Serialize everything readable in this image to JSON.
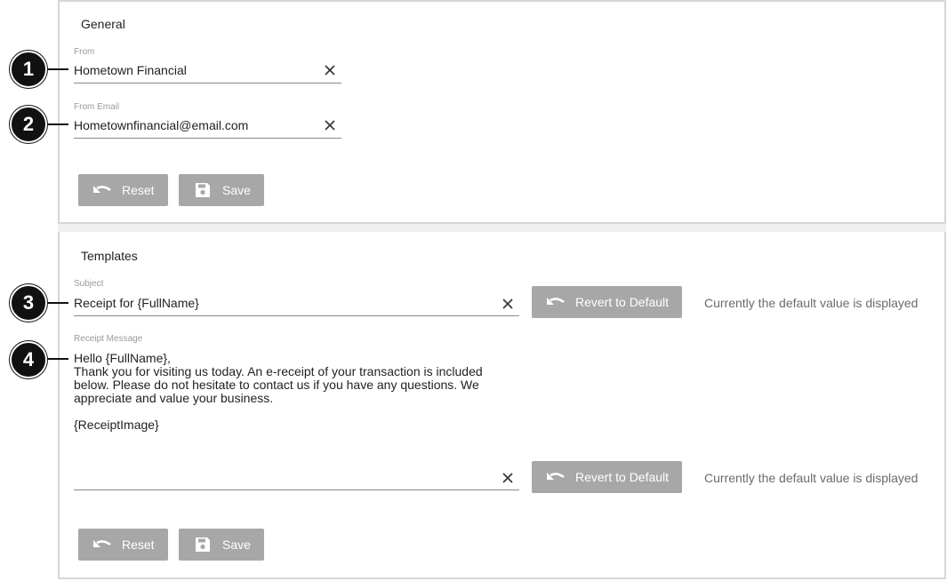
{
  "general": {
    "title": "General",
    "from": {
      "label": "From",
      "value": "Hometown Financial"
    },
    "from_email": {
      "label": "From Email",
      "value": "Hometownfinancial@email.com"
    },
    "reset_label": "Reset",
    "save_label": "Save"
  },
  "templates": {
    "title": "Templates",
    "subject": {
      "label": "Subject",
      "value": "Receipt for {FullName}"
    },
    "receipt_message": {
      "label": "Receipt Message",
      "lines": [
        "Hello {FullName},",
        "Thank you for visiting us today. An e-receipt of your transaction is included",
        "below. Please do not hesitate to contact us if you have any questions. We",
        "appreciate and value your business.",
        "",
        "{ReceiptImage}"
      ]
    },
    "revert_label": "Revert to Default",
    "default_hint": "Currently the default value is displayed",
    "reset_label": "Reset",
    "save_label": "Save"
  },
  "callouts": [
    "1",
    "2",
    "3",
    "4"
  ],
  "icons": {
    "clear": "close-icon",
    "undo": "undo-icon",
    "save": "floppy-disk-icon"
  },
  "colors": {
    "button_bg": "#a7a7a7",
    "callout_bg": "#111111"
  }
}
